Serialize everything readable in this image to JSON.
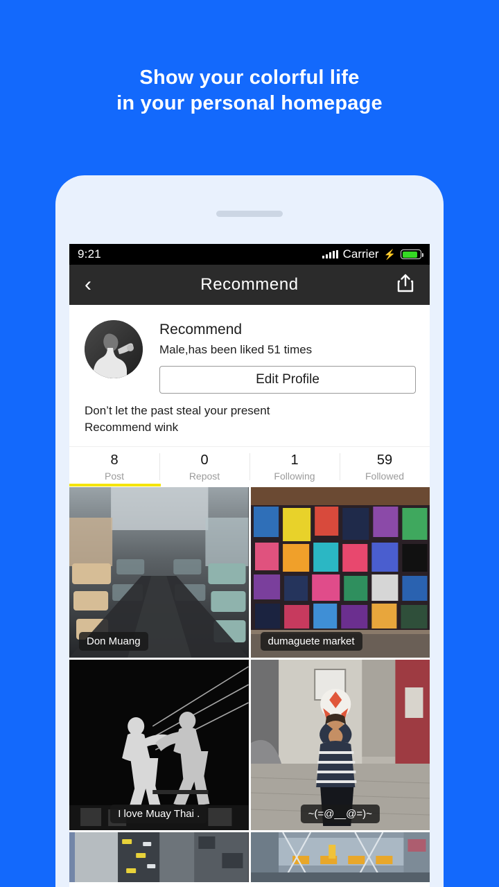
{
  "promo": {
    "line1": "Show your colorful life",
    "line2": "in your personal homepage",
    "background_color": "#1369fc",
    "text_color": "#ffffff"
  },
  "phone": {
    "frame_color": "#e9f1fd",
    "speaker_name": "speaker-grille"
  },
  "status_bar": {
    "time": "9:21",
    "carrier": "Carrier",
    "signal_icon": "signal-bars-icon",
    "charging_icon": "lightning-bolt-icon",
    "battery_icon": "battery-icon",
    "battery_level": "85",
    "battery_color": "#35d924",
    "background_color": "#000000"
  },
  "nav_bar": {
    "back_icon": "chevron-left-icon",
    "title": "Recommend",
    "share_icon": "share-upload-icon",
    "background_color": "#2b2b2b"
  },
  "profile": {
    "avatar_name": "user-avatar",
    "name": "Recommend",
    "meta": "Male,has been liked 51 times",
    "edit_button_label": "Edit Profile",
    "bio_line1": "Don’t let the past steal your present",
    "bio_line2": "Recommend wink"
  },
  "stats": {
    "tab_indicator_color": "#f5e400",
    "items": [
      {
        "value": "8",
        "label": "Post"
      },
      {
        "value": "0",
        "label": "Repost"
      },
      {
        "value": "1",
        "label": "Following"
      },
      {
        "value": "59",
        "label": "Followed"
      }
    ]
  },
  "grid": {
    "photos": [
      {
        "caption": "Don Muang",
        "alt": "airport-terminal-seating-photo"
      },
      {
        "caption": "dumaguete market",
        "alt": "market-bags-stall-photo"
      },
      {
        "caption": "I love Muay Thai .",
        "alt": "muay-thai-fighters-photo"
      },
      {
        "caption": "~(=@__@=)~",
        "alt": "boy-with-ball-photo"
      },
      {
        "caption": "",
        "alt": "city-street-aerial-photo"
      },
      {
        "caption": "",
        "alt": "building-facade-photo"
      }
    ]
  }
}
